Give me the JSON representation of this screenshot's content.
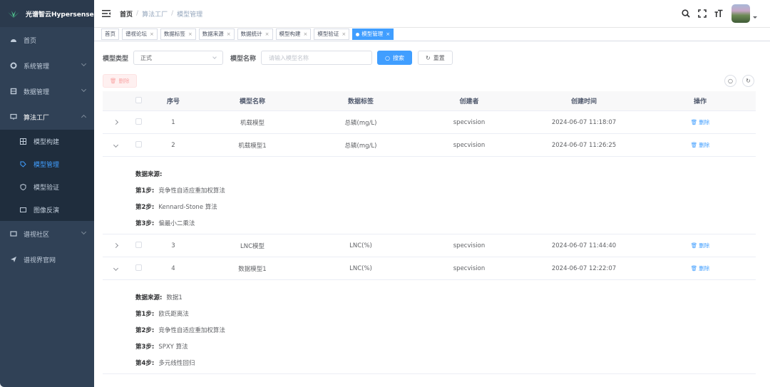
{
  "app": {
    "brand": "光谱智云Hypersense"
  },
  "sidebar": {
    "items": [
      {
        "label": "首页"
      },
      {
        "label": "系统管理"
      },
      {
        "label": "数据管理"
      },
      {
        "label": "算法工厂"
      },
      {
        "label": "谱视社区"
      },
      {
        "label": "谱视界官网"
      }
    ],
    "sub": [
      {
        "label": "模型构建"
      },
      {
        "label": "模型管理"
      },
      {
        "label": "模型验证"
      },
      {
        "label": "图像反演"
      }
    ]
  },
  "header": {
    "breadcrumb": [
      "首页",
      "算法工厂",
      "模型管理"
    ]
  },
  "tags": [
    "首页",
    "谱视论坛",
    "数据标签",
    "数据来源",
    "数据统计",
    "模型构建",
    "模型验证",
    "模型管理"
  ],
  "filter": {
    "type_label": "模型类型",
    "type_value": "正式",
    "name_label": "模型名称",
    "name_placeholder": "请输入模型名称",
    "search": "搜索",
    "reset": "重置"
  },
  "toolbar": {
    "delete": "删除"
  },
  "table": {
    "headers": [
      "序号",
      "模型名称",
      "数据标签",
      "创建者",
      "创建时间",
      "操作"
    ],
    "op_label": "删除",
    "rows": [
      {
        "idx": "1",
        "name": "机载模型",
        "label": "总磷(mg/L)",
        "creator": "specvision",
        "time": "2024-06-07 11:18:07"
      },
      {
        "idx": "2",
        "name": "机载模型1",
        "label": "总磷(mg/L)",
        "creator": "specvision",
        "time": "2024-06-07 11:26:25",
        "detail": [
          {
            "k": "数据来源:",
            "v": ""
          },
          {
            "k": "第1步:",
            "v": "竞争性自适应重加权算法"
          },
          {
            "k": "第2步:",
            "v": "Kennard-Stone 算法"
          },
          {
            "k": "第3步:",
            "v": "偏最小二乘法"
          }
        ]
      },
      {
        "idx": "3",
        "name": "LNC模型",
        "label": "LNC(%)",
        "creator": "specvision",
        "time": "2024-06-07 11:44:40"
      },
      {
        "idx": "4",
        "name": "数据模型1",
        "label": "LNC(%)",
        "creator": "specvision",
        "time": "2024-06-07 12:22:07",
        "detail": [
          {
            "k": "数据来源:",
            "v": "数据1"
          },
          {
            "k": "第1步:",
            "v": "欧氏距离法"
          },
          {
            "k": "第2步:",
            "v": "竞争性自适应重加权算法"
          },
          {
            "k": "第3步:",
            "v": "SPXY 算法"
          },
          {
            "k": "第4步:",
            "v": "多元线性回归"
          }
        ]
      }
    ]
  },
  "colors": {
    "sidebar": "#304156",
    "accent": "#409eff",
    "danger": "#f56c6c"
  }
}
